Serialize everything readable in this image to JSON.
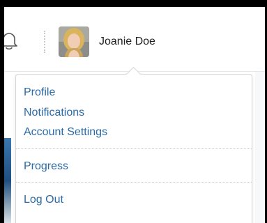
{
  "header": {
    "icons": {
      "notifications": "bell-icon",
      "user_avatar": "user-avatar-photo"
    },
    "user_name": "Joanie Doe"
  },
  "menu": {
    "profile": "Profile",
    "notifications": "Notifications",
    "account_settings": "Account Settings",
    "progress": "Progress",
    "log_out": "Log Out"
  },
  "colors": {
    "link": "#2a6ba6",
    "text": "#202122",
    "border": "#d3d7da"
  }
}
